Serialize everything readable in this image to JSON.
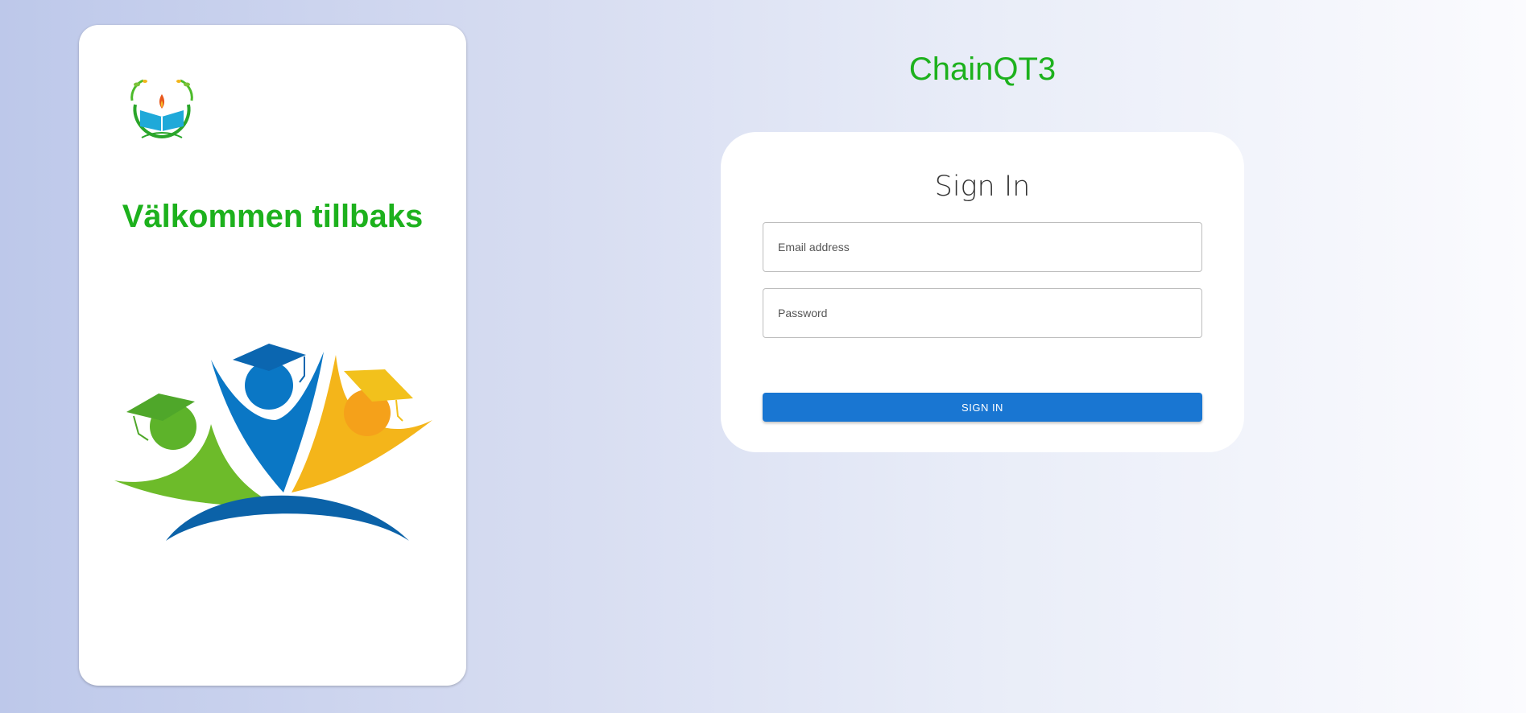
{
  "left_panel": {
    "welcome_text": "Välkommen tillbaks"
  },
  "app": {
    "title": "ChainQT3"
  },
  "signin": {
    "title": "Sign In",
    "email_placeholder": "Email address",
    "password_placeholder": "Password",
    "button_label": "SIGN IN"
  },
  "icons": {
    "small_logo": "book-flame-logo-icon",
    "hero_logo": "graduates-logo-icon"
  },
  "colors": {
    "accent_green": "#1db11d",
    "button_blue": "#1976d2"
  }
}
